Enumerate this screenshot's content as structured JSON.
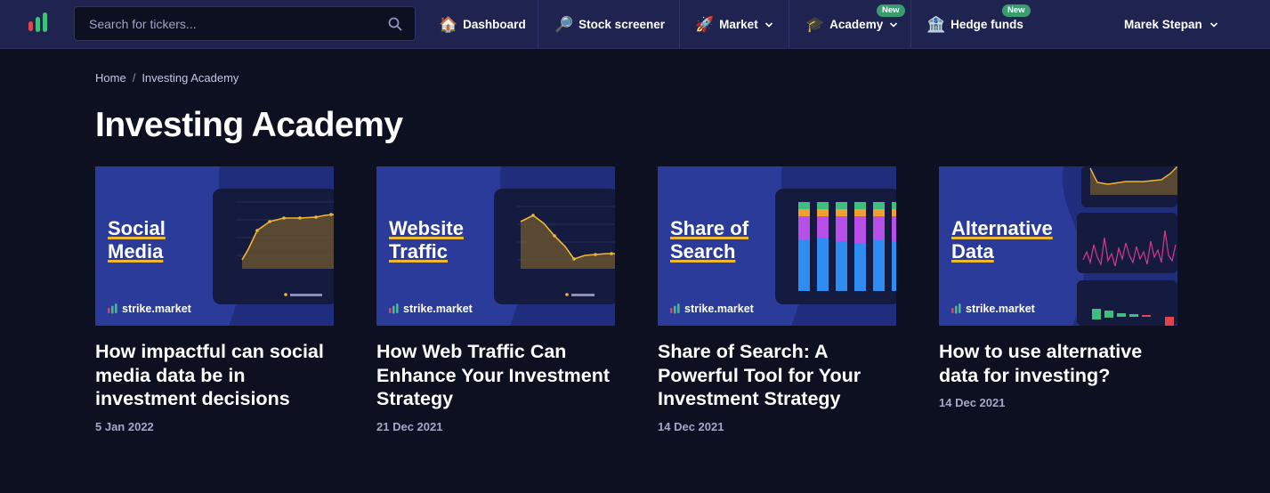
{
  "search": {
    "placeholder": "Search for tickers..."
  },
  "nav": {
    "dashboard": {
      "label": "Dashboard",
      "emoji": "🏠"
    },
    "screener": {
      "label": "Stock screener",
      "emoji": "🔎"
    },
    "market": {
      "label": "Market",
      "emoji": "🚀"
    },
    "academy": {
      "label": "Academy",
      "emoji": "🎓",
      "badge": "New"
    },
    "hedge": {
      "label": "Hedge funds",
      "emoji": "🏦",
      "badge": "New"
    }
  },
  "user": {
    "name": "Marek Stepan"
  },
  "breadcrumb": {
    "home": "Home",
    "sep": "/",
    "current": "Investing Academy"
  },
  "page": {
    "title": "Investing Academy"
  },
  "brand": {
    "name": "strike.market"
  },
  "colors": {
    "navbar": "#1e2350",
    "background": "#0d1021",
    "thumb": "#2a3b9a",
    "accent": "#f0b730",
    "badge": "#3a9d6f"
  },
  "cards": [
    {
      "thumb_title": "Social\nMedia",
      "title": "How impactful can social media data be in investment decisions",
      "date": "5 Jan 2022"
    },
    {
      "thumb_title": "Website\nTraffic",
      "title": "How Web Traffic Can Enhance Your Investment Strategy",
      "date": "21 Dec 2021"
    },
    {
      "thumb_title": "Share of\nSearch",
      "title": "Share of Search: A Powerful Tool for Your Investment Strategy",
      "date": "14 Dec 2021"
    },
    {
      "thumb_title": "Alternative\nData",
      "title": "How to use alternative data for investing?",
      "date": "14 Dec 2021"
    }
  ]
}
